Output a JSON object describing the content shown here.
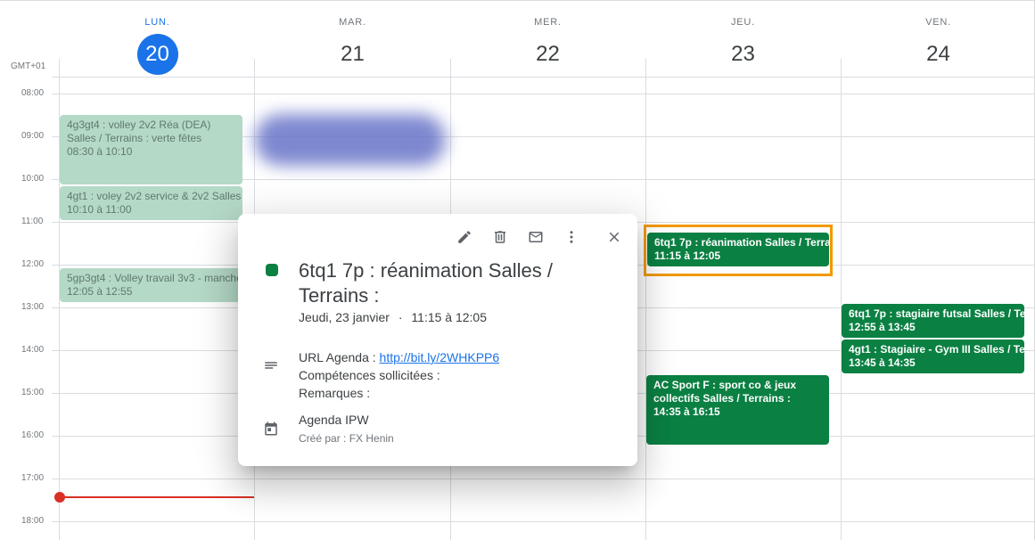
{
  "timezone": "GMT+01",
  "days": [
    {
      "name": "LUN.",
      "num": "20"
    },
    {
      "name": "MAR.",
      "num": "21"
    },
    {
      "name": "MER.",
      "num": "22"
    },
    {
      "name": "JEU.",
      "num": "23"
    },
    {
      "name": "VEN.",
      "num": "24"
    }
  ],
  "today_index": 0,
  "hours": [
    "08:00",
    "09:00",
    "10:00",
    "11:00",
    "12:00",
    "13:00",
    "14:00",
    "15:00",
    "16:00",
    "17:00",
    "18:00"
  ],
  "events": {
    "mon1": {
      "title": "4g3gt4 : volley 2v2 Réa (DEA) Salles / Terrains : verte fêtes",
      "time": "08:30 à 10:10"
    },
    "mon2": {
      "title": "4gt1 : voley 2v2 service & 2v2 Salles",
      "time": "10:10 à 11:00"
    },
    "mon3": {
      "title": "5gp3gt4 : Volley travail 3v3 - manche",
      "time": "12:05 à 12:55"
    },
    "thu1": {
      "title": "6tq1 7p : réanimation Salles / Terrains",
      "time": "11:15 à 12:05"
    },
    "thu2": {
      "title": "AC Sport F : sport co & jeux collectifs Salles / Terrains :",
      "time": "14:35 à 16:15"
    },
    "fri1": {
      "title": "6tq1 7p : stagiaire futsal Salles / Terrains",
      "time": "12:55 à 13:45"
    },
    "fri2": {
      "title": "4gt1 : Stagiaire - Gym III Salles / Terrains",
      "time": "13:45 à 14:35"
    }
  },
  "colors": {
    "event_past": "#b5d9c7",
    "event_future": "#0b8043",
    "today": "#1a73e8",
    "now_line": "#d93025",
    "highlight": "#f29900"
  },
  "popup": {
    "toolbar_icons": [
      "edit-icon",
      "delete-icon",
      "email-icon",
      "more-options-icon",
      "close-icon"
    ],
    "title": "6tq1 7p : réanimation Salles / Terrains :",
    "date": "Jeudi, 23 janvier",
    "separator": "·",
    "time": "11:15 à 12:05",
    "url_label": "URL Agenda : ",
    "url": "http://bit.ly/2WHKPP6",
    "skills": "Compétences sollicitées :",
    "remarks": "Remarques :",
    "calendar": "Agenda IPW",
    "creator": "Créé par : FX Henin"
  }
}
